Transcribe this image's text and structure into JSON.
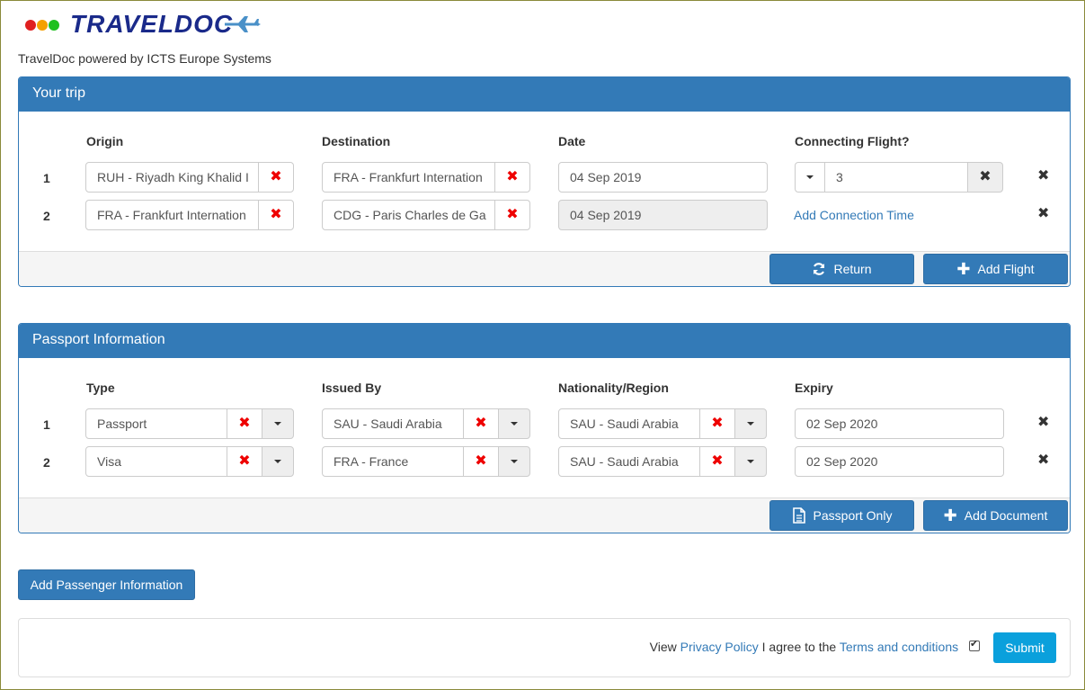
{
  "header": {
    "logo_text": "TRAVELDOC",
    "logo_colors": [
      "#e02020",
      "#f5a000",
      "#20c020"
    ],
    "powered_by": "TravelDoc powered by ICTS Europe Systems"
  },
  "trip": {
    "title": "Your trip",
    "columns": {
      "origin": "Origin",
      "destination": "Destination",
      "date": "Date",
      "connecting": "Connecting Flight?"
    },
    "rows": [
      {
        "num": "1",
        "origin": "RUH - Riyadh King Khalid I",
        "destination": "FRA - Frankfurt Internation",
        "date": "04 Sep 2019",
        "connecting_value": "3"
      },
      {
        "num": "2",
        "origin": "FRA - Frankfurt Internation",
        "destination": "CDG - Paris Charles de Ga",
        "date": "04 Sep 2019",
        "connection_link": "Add Connection Time"
      }
    ],
    "buttons": {
      "return": "Return",
      "add_flight": "Add Flight"
    }
  },
  "passport": {
    "title": "Passport Information",
    "columns": {
      "type": "Type",
      "issued_by": "Issued By",
      "nationality": "Nationality/Region",
      "expiry": "Expiry"
    },
    "rows": [
      {
        "num": "1",
        "type": "Passport",
        "issued_by": "SAU - Saudi Arabia",
        "nationality": "SAU - Saudi Arabia",
        "expiry": "02 Sep 2020"
      },
      {
        "num": "2",
        "type": "Visa",
        "issued_by": "FRA - France",
        "nationality": "SAU - Saudi Arabia",
        "expiry": "02 Sep 2020"
      }
    ],
    "buttons": {
      "passport_only": "Passport Only",
      "add_document": "Add Document"
    }
  },
  "add_passenger": "Add Passenger Information",
  "footer": {
    "view": "View",
    "privacy_policy": "Privacy Policy",
    "agree_text": "I agree to the",
    "terms": "Terms and conditions",
    "submit": "Submit"
  }
}
